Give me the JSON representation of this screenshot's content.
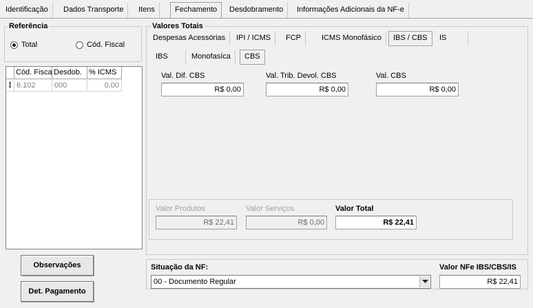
{
  "tabs": [
    {
      "label": "Identificação"
    },
    {
      "label": "Dados Transporte"
    },
    {
      "label": "Itens"
    },
    {
      "label": "Fechamento"
    },
    {
      "label": "Desdobramento"
    },
    {
      "label": "Informações Adicionais da NF-e"
    }
  ],
  "referencia": {
    "title": "Referência",
    "radio_total": "Total",
    "radio_cod_fiscal": "Cód. Fiscal",
    "selected": "Total"
  },
  "grid": {
    "columns": [
      "Cód. Fiscal",
      "Desdob.",
      "% ICMS"
    ],
    "rows": [
      {
        "cod_fiscal": "6.102",
        "desdob": "000",
        "icms": "0,00"
      }
    ]
  },
  "valores": {
    "title": "Valores Totais",
    "tabs_row1": [
      "Despesas Acessórias",
      "IPI / ICMS",
      "FCP",
      "ICMS Monofásico",
      "IBS / CBS",
      "IS"
    ],
    "tabs_row2": [
      "IBS",
      "Monofasíca",
      "CBS"
    ],
    "fields": {
      "val_dif_cbs_label": "Val. Dif. CBS",
      "val_dif_cbs": "R$ 0,00",
      "val_trib_devol_cbs_label": "Val. Trib. Devol. CBS",
      "val_trib_devol_cbs": "R$ 0,00",
      "val_cbs_label": "Val. CBS",
      "val_cbs": "R$ 0,00"
    },
    "totals": {
      "valor_produtos_label": "Valor Produtos",
      "valor_produtos": "R$ 22,41",
      "valor_servicos_label": "Valor Serviços",
      "valor_servicos": "R$ 0,00",
      "valor_total_label": "Valor Total",
      "valor_total": "R$ 22,41"
    }
  },
  "buttons": {
    "observacoes": "Observações",
    "det_pagamento": "Det. Pagamento"
  },
  "situacao": {
    "label": "Situação da NF:",
    "value": "00 - Documento Regular"
  },
  "valor_nfe": {
    "label": "Valor NFe IBS/CBS/IS",
    "value": "R$ 22,41"
  }
}
